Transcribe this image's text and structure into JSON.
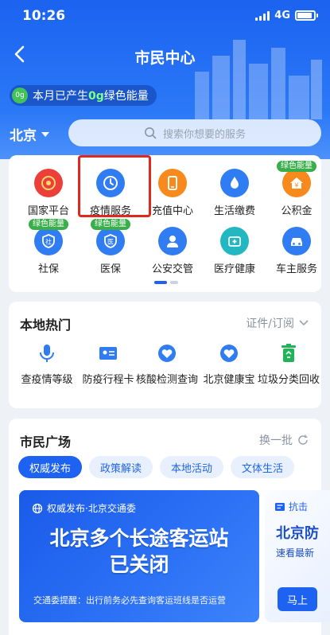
{
  "status": {
    "time": "10:26",
    "network": "4G"
  },
  "header": {
    "title": "市民中心",
    "energy_prefix": "本月已产生",
    "energy_value": "0g",
    "energy_suffix": "绿色能量",
    "energy_icon_text": "0g"
  },
  "location": {
    "city": "北京"
  },
  "search": {
    "placeholder": "搜索你想要的服务"
  },
  "services": [
    {
      "label": "国家平台",
      "icon": "national-emblem-icon",
      "color": "#ec3f3a"
    },
    {
      "label": "疫情服务",
      "icon": "clock-refresh-icon",
      "color": "#2f7cf3"
    },
    {
      "label": "充值中心",
      "icon": "phone-icon",
      "color": "#f7891d"
    },
    {
      "label": "生活缴费",
      "icon": "water-drop-icon",
      "color": "#2f7cf3"
    },
    {
      "label": "公积金",
      "icon": "house-yuan-icon",
      "color": "#f7891d",
      "badge": "绿色能量"
    },
    {
      "label": "社保",
      "icon": "shield-she-icon",
      "color": "#2f7cf3",
      "badge": "绿色能量"
    },
    {
      "label": "医保",
      "icon": "shield-yi-icon",
      "color": "#2f7cf3",
      "badge": "绿色能量"
    },
    {
      "label": "公安交管",
      "icon": "police-icon",
      "color": "#2f7cf3"
    },
    {
      "label": "医疗健康",
      "icon": "medical-kit-icon",
      "color": "#23b7c2"
    },
    {
      "label": "车主服务",
      "icon": "car-icon",
      "color": "#2f7cf3"
    }
  ],
  "hot": {
    "title": "本地热门",
    "more": "证件/订阅",
    "items": [
      {
        "label": "查疫情等级",
        "icon": "microphone-icon"
      },
      {
        "label": "防疫行程卡",
        "icon": "id-card-icon"
      },
      {
        "label": "核酸检测查询",
        "icon": "heart-plus-icon"
      },
      {
        "label": "北京健康宝",
        "icon": "heart-plus-icon"
      },
      {
        "label": "垃圾分类回收",
        "icon": "trash-recycle-icon"
      }
    ]
  },
  "plaza": {
    "title": "市民广场",
    "refresh": "换一批",
    "tabs": [
      "权威发布",
      "政策解读",
      "本地活动",
      "文体生活"
    ],
    "banner": {
      "tag": "权威发布·北京交通委",
      "headline_line1": "北京多个长途客运站",
      "headline_line2": "已关闭",
      "footer": "交通委提醒：出行前务必先查询客运班线是否运营"
    },
    "banner2": {
      "tag": "抗击",
      "headline": "北京防",
      "sub": "速看最新",
      "button": "马上"
    }
  },
  "colors": {
    "brand": "#1d62f0",
    "green": "#3aae4a",
    "highlight": "#e0281f"
  }
}
